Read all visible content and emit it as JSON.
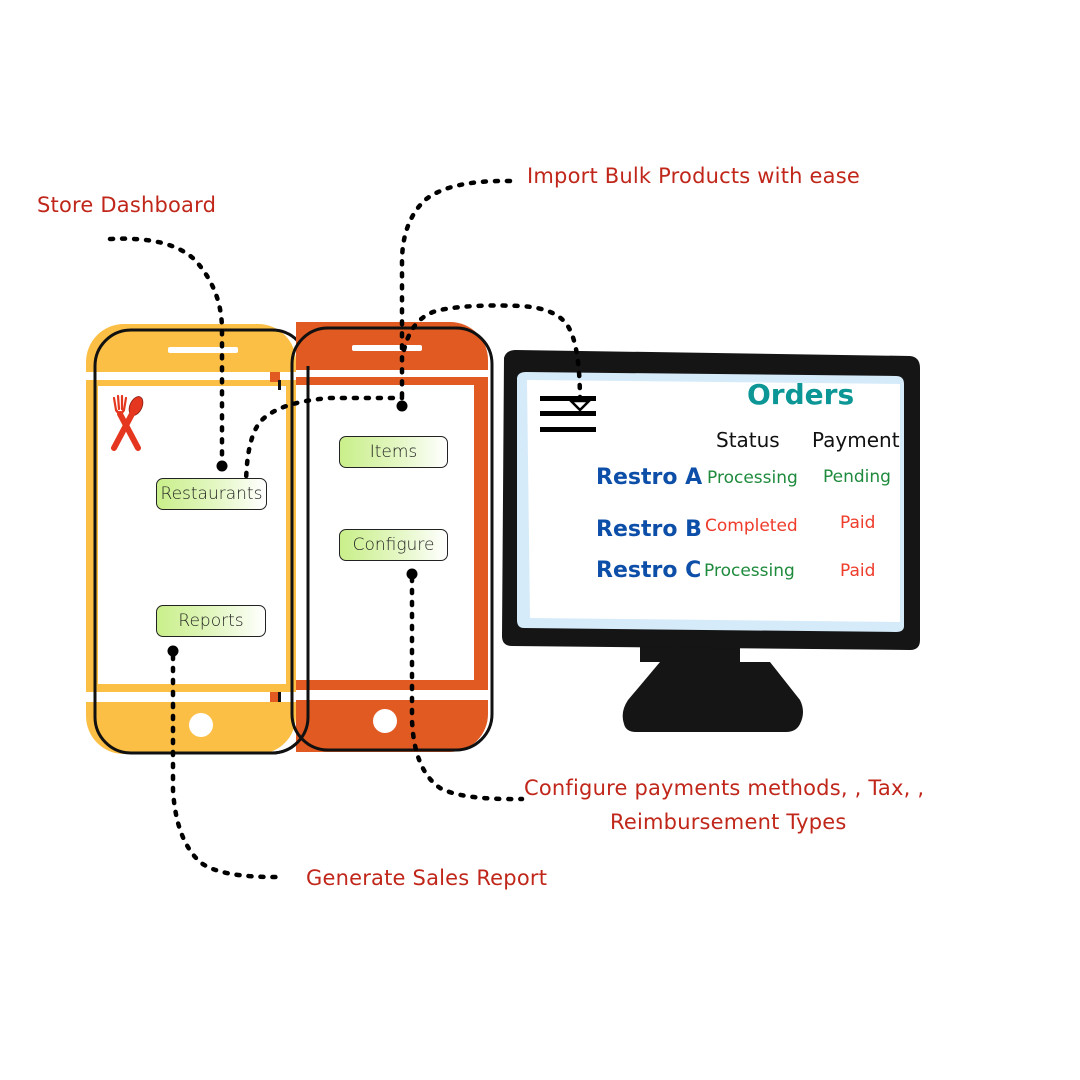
{
  "callouts": {
    "store_dashboard": "Store Dashboard",
    "import_bulk": "Import Bulk Products with ease",
    "configure_line1": "Configure payments methods, , Tax, ,",
    "configure_line2": "Reimbursement Types",
    "sales_report": "Generate Sales Report"
  },
  "phone_left": {
    "icon": "fork-spoon-icon",
    "buttons": {
      "restaurants": "Restaurants",
      "reports": "Reports"
    }
  },
  "phone_right": {
    "buttons": {
      "items": "Items",
      "configure": "Configure"
    }
  },
  "monitor": {
    "menu_icon": "hamburger-menu-icon",
    "title": "Orders",
    "columns": {
      "status": "Status",
      "payment": "Payment"
    },
    "rows": [
      {
        "name": "Restro A",
        "status": "Processing",
        "payment": "Pending",
        "status_color": "#1e8a3c",
        "payment_color": "#1e8a3c"
      },
      {
        "name": "Restro B",
        "status": "Completed",
        "payment": "Paid",
        "status_color": "#ee3b2a",
        "payment_color": "#ee3b2a"
      },
      {
        "name": "Restro C",
        "status": "Processing",
        "payment": "Paid",
        "status_color": "#1e8a3c",
        "payment_color": "#ee3b2a"
      }
    ]
  },
  "colors": {
    "callout_red": "#c0271a",
    "phone_yellow": "#fbbf45",
    "phone_orange": "#e05a22",
    "orders_teal": "#0c9696",
    "restro_blue": "#0d4fa8",
    "status_green": "#1e8a3c",
    "status_red": "#ee3b2a"
  }
}
